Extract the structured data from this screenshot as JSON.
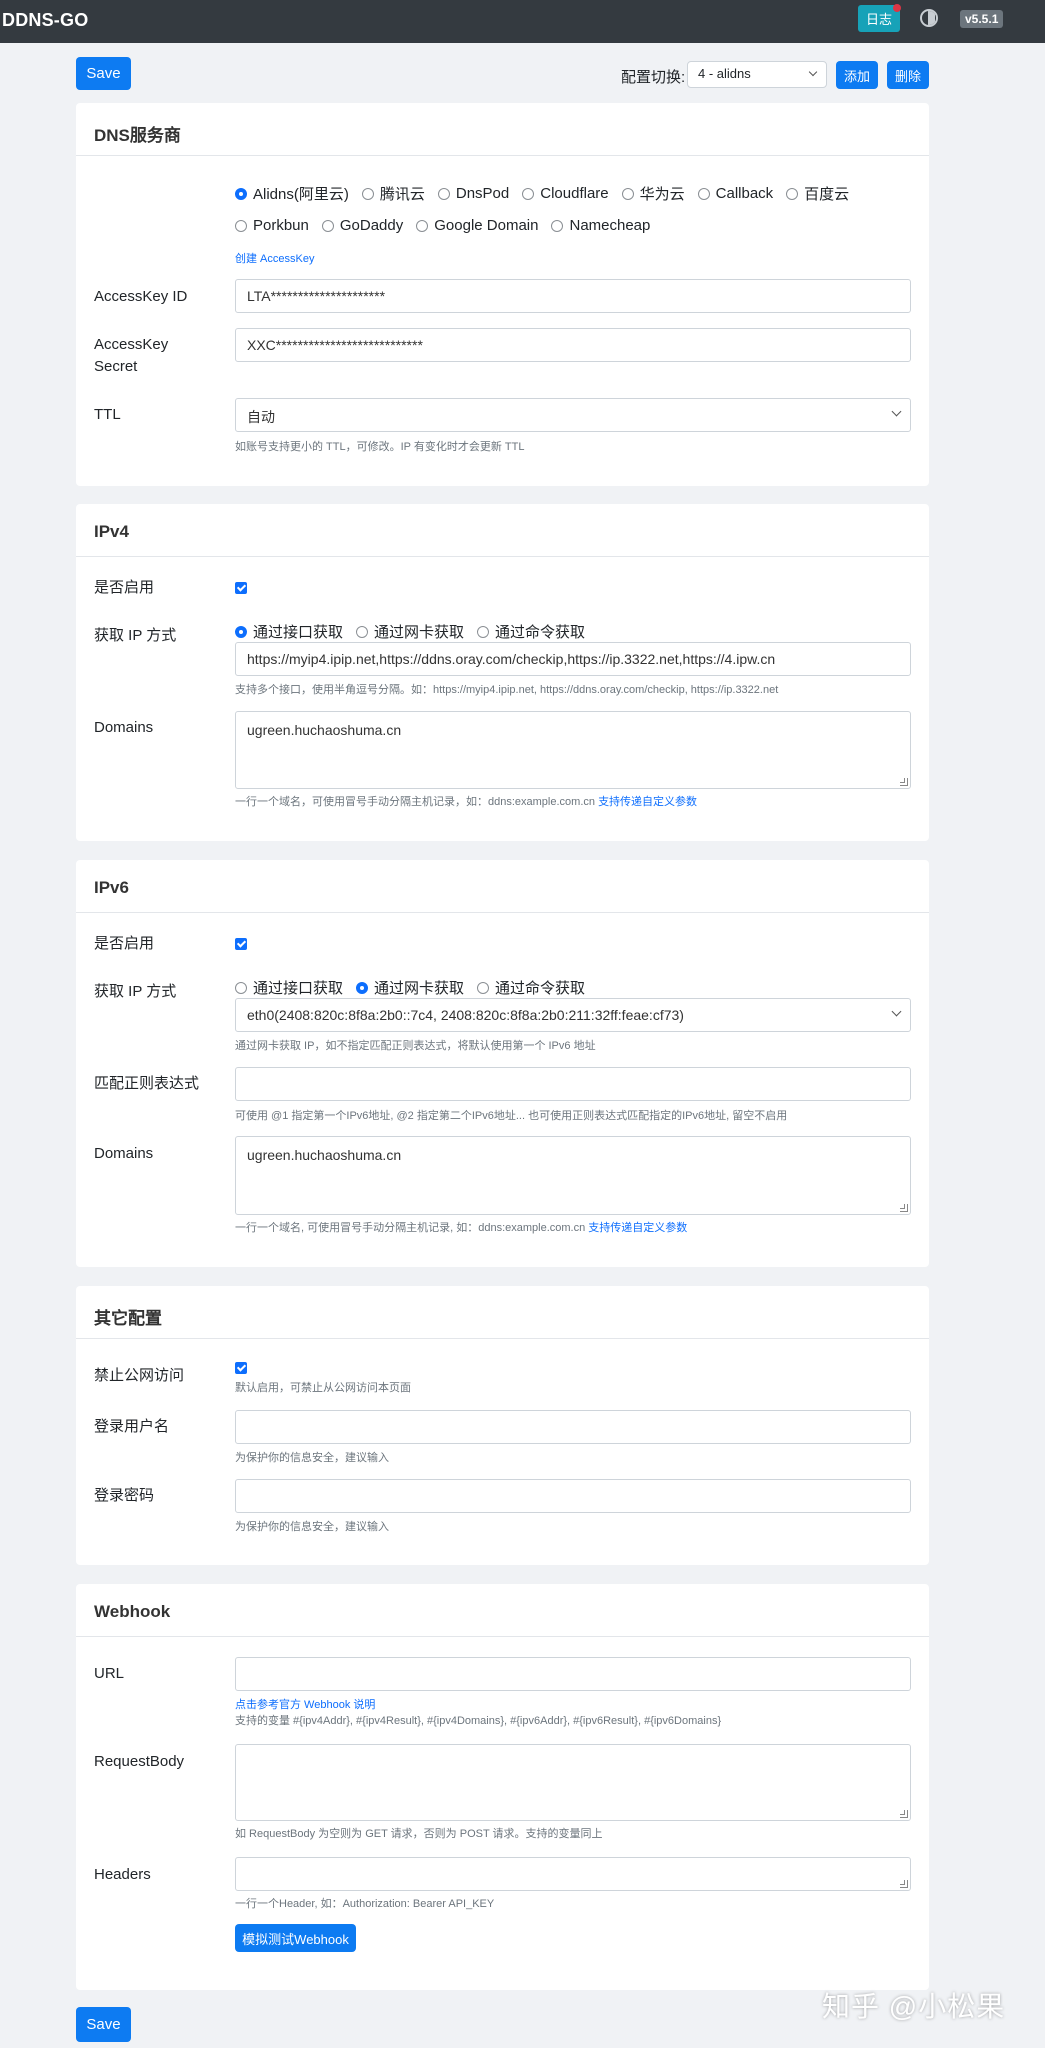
{
  "topbar": {
    "brand": "DDNS-GO",
    "log_label": "日志",
    "version": "v5.5.1"
  },
  "toolbar": {
    "save_label": "Save",
    "config_label": "配置切换:",
    "config_selected": "4 - alidns",
    "add_label": "添加",
    "delete_label": "删除"
  },
  "dns": {
    "title": "DNS服务商",
    "providers": [
      "Alidns(阿里云)",
      "腾讯云",
      "DnsPod",
      "Cloudflare",
      "华为云",
      "Callback",
      "百度云",
      "Porkbun",
      "GoDaddy",
      "Google Domain",
      "Namecheap"
    ],
    "create_key_link": "创建 AccessKey",
    "access_key_id_label": "AccessKey ID",
    "access_key_id_value": "LTA*********************",
    "access_key_secret_label_1": "AccessKey",
    "access_key_secret_label_2": "Secret",
    "access_key_secret_value": "XXC***************************",
    "ttl_label": "TTL",
    "ttl_value": "自动",
    "ttl_help": "如账号支持更小的 TTL，可修改。IP 有变化时才会更新 TTL"
  },
  "ipv4": {
    "title": "IPv4",
    "enable_label": "是否启用",
    "method_label": "获取 IP 方式",
    "methods": [
      "通过接口获取",
      "通过网卡获取",
      "通过命令获取"
    ],
    "url_value": "https://myip4.ipip.net,https://ddns.oray.com/checkip,https://ip.3322.net,https://4.ipw.cn",
    "url_help": "支持多个接口，使用半角逗号分隔。如：https://myip4.ipip.net, https://ddns.oray.com/checkip, https://ip.3322.net",
    "domains_label": "Domains",
    "domains_value": "ugreen.huchaoshuma.cn",
    "domains_help": "一行一个域名，可使用冒号手动分隔主机记录，如：ddns:example.com.cn",
    "domains_help_link": "支持传递自定义参数"
  },
  "ipv6": {
    "title": "IPv6",
    "enable_label": "是否启用",
    "method_label": "获取 IP 方式",
    "methods": [
      "通过接口获取",
      "通过网卡获取",
      "通过命令获取"
    ],
    "nic_value": "eth0(2408:820c:8f8a:2b0::7c4, 2408:820c:8f8a:2b0:211:32ff:feae:cf73)",
    "nic_help": "通过网卡获取 IP，如不指定匹配正则表达式，将默认使用第一个 IPv6 地址",
    "regex_label": "匹配正则表达式",
    "regex_help": "可使用 @1 指定第一个IPv6地址, @2 指定第二个IPv6地址... 也可使用正则表达式匹配指定的IPv6地址, 留空不启用",
    "domains_label": "Domains",
    "domains_value": "ugreen.huchaoshuma.cn",
    "domains_help": "一行一个域名, 可使用冒号手动分隔主机记录, 如：ddns:example.com.cn",
    "domains_help_link": "支持传递自定义参数"
  },
  "other": {
    "title": "其它配置",
    "public_label": "禁止公网访问",
    "public_help": "默认启用，可禁止从公网访问本页面",
    "username_label": "登录用户名",
    "username_help": "为保护你的信息安全，建议输入",
    "password_label": "登录密码",
    "password_help": "为保护你的信息安全，建议输入"
  },
  "webhook": {
    "title": "Webhook",
    "url_label": "URL",
    "doc_link": "点击参考官方 Webhook 说明",
    "vars_help": "支持的变量 #{ipv4Addr}, #{ipv4Result}, #{ipv4Domains}, #{ipv6Addr}, #{ipv6Result}, #{ipv6Domains}",
    "body_label": "RequestBody",
    "body_help": "如 RequestBody 为空则为 GET 请求，否则为 POST 请求。支持的变量同上",
    "headers_label": "Headers",
    "headers_help": "一行一个Header, 如：Authorization: Bearer API_KEY",
    "test_label": "模拟测试Webhook"
  },
  "watermark": "知乎 @小松果"
}
